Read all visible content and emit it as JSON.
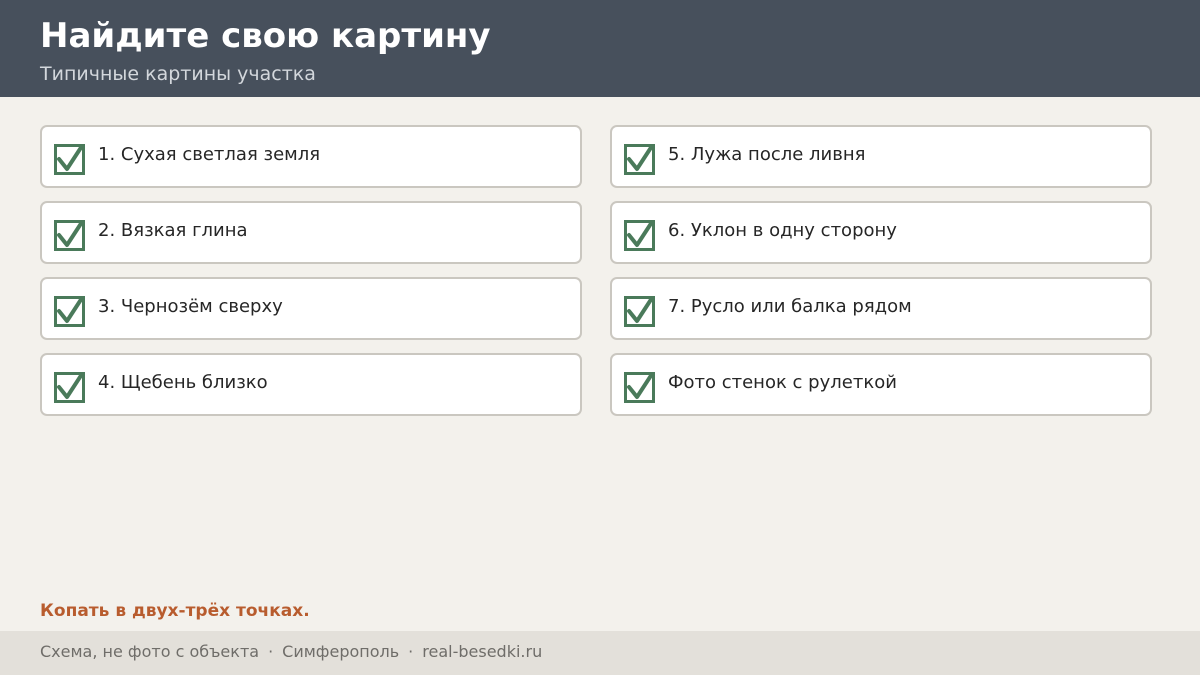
{
  "header": {
    "title": "Найдите свою картину",
    "subtitle": "Типичные картины участка"
  },
  "items": [
    {
      "label": "1. Сухая светлая земля",
      "checked": true
    },
    {
      "label": "2. Вязкая глина",
      "checked": true
    },
    {
      "label": "3. Чернозём сверху",
      "checked": true
    },
    {
      "label": "4. Щебень близко",
      "checked": true
    },
    {
      "label": "5. Лужа после ливня",
      "checked": true
    },
    {
      "label": "6. Уклон в одну сторону",
      "checked": true
    },
    {
      "label": "7. Русло или балка рядом",
      "checked": true
    },
    {
      "label": "Фото стенок с рулеткой",
      "checked": true
    }
  ],
  "note": "Копать в двух-трёх точках.",
  "footer": {
    "caption": "Схема, не фото с объекта",
    "separator": "·",
    "city": "Симферополь",
    "site": "real-besedki.ru"
  },
  "colors": {
    "header_bg": "#47505c",
    "check": "#4a7a5a",
    "note": "#b85c2e",
    "page_bg": "#f3f1ec",
    "footer_bg": "#e3e0da"
  },
  "icons": {
    "check": "checkbox-checked-icon"
  }
}
